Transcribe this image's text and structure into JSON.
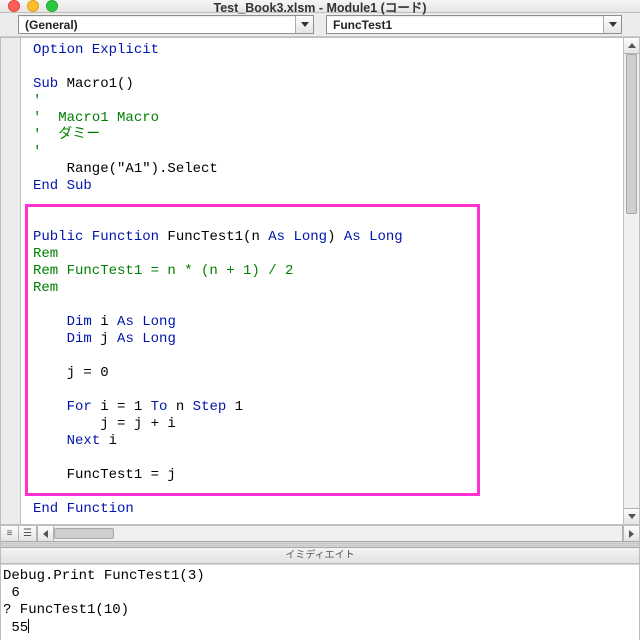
{
  "window": {
    "title": "Test_Book3.xlsm - Module1 (コード)"
  },
  "dropdowns": {
    "object": "(General)",
    "procedure": "FuncTest1"
  },
  "code": {
    "option_explicit": "Option Explicit",
    "sub_kw": "Sub",
    "macro_name": "Macro1()",
    "apos": "'",
    "macro_comment1": "  Macro1 Macro",
    "macro_comment2": "  ダミー",
    "range_sel": "    Range(\"A1\").Select",
    "end_sub": "End Sub",
    "public_function": "Public Function",
    "func_sig_mid": " FuncTest1(n ",
    "as_long_close": ") ",
    "as_long": "As Long",
    "rem": "Rem",
    "rem_formula": "Rem FuncTest1 = n * (n + 1) / 2",
    "dim_kw": "Dim",
    "var_i": " i ",
    "var_j": " j ",
    "j_zero": "    j = 0",
    "for_kw": "For",
    "for_mid": " i = 1 ",
    "to_kw": "To",
    "for_mid2": " n ",
    "step_kw": "Step",
    "for_end": " 1",
    "body_assign": "        j = j + i",
    "next_kw": "Next",
    "next_var": " i",
    "ret": "    FuncTest1 = j",
    "end_function": "End Function"
  },
  "immediate": {
    "title": "イミディエイト",
    "lines": [
      "Debug.Print FuncTest1(3)",
      " 6 ",
      "? FuncTest1(10)",
      " 55"
    ]
  },
  "icons": {
    "viewmode1": "≡",
    "viewmode2": "☰"
  }
}
